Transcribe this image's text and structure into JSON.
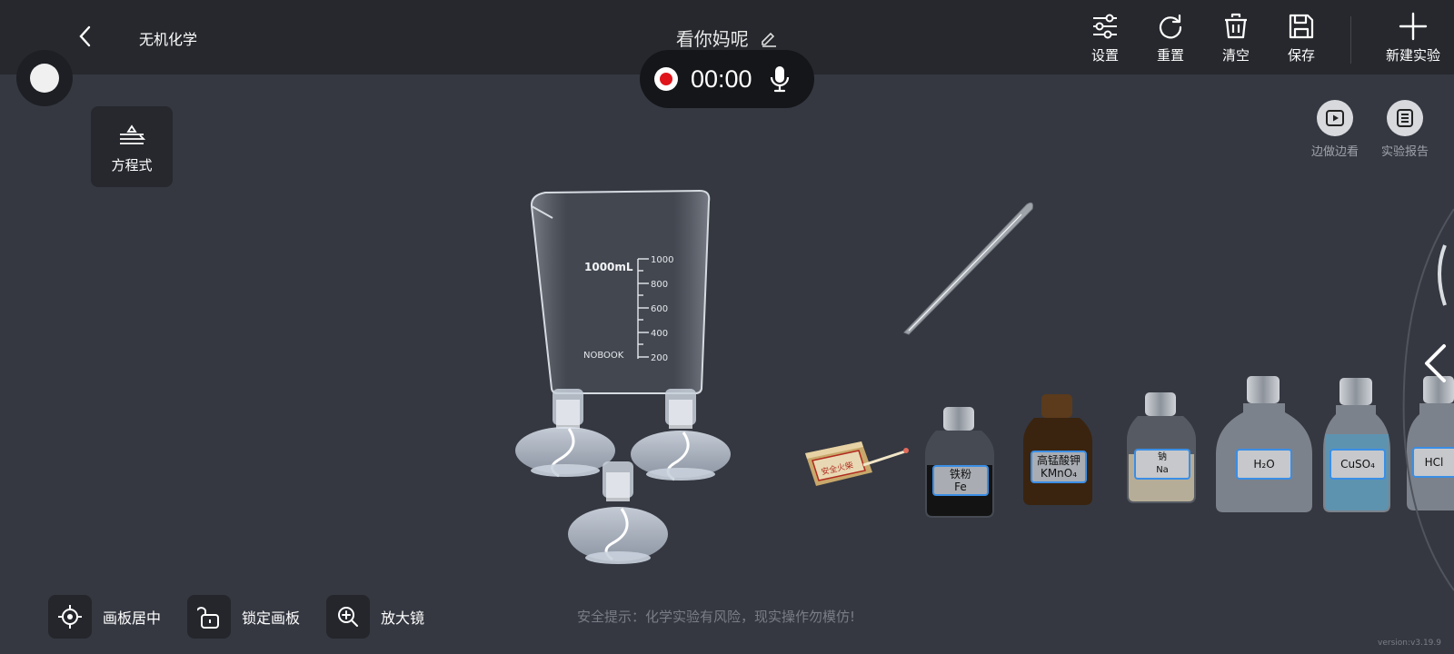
{
  "header": {
    "app_title": "无机化学",
    "experiment_title": "看你妈呢",
    "tools": [
      {
        "id": "settings",
        "label": "设置",
        "icon": "sliders-icon"
      },
      {
        "id": "reset",
        "label": "重置",
        "icon": "refresh-icon"
      },
      {
        "id": "clear",
        "label": "清空",
        "icon": "trash-icon"
      },
      {
        "id": "save",
        "label": "保存",
        "icon": "save-icon"
      },
      {
        "id": "new",
        "label": "新建实验",
        "icon": "plus-icon"
      }
    ]
  },
  "recorder": {
    "time": "00:00"
  },
  "left_panel": {
    "equation_label": "方程式"
  },
  "right_panel": {
    "watch_label": "边做边看",
    "report_label": "实验报告"
  },
  "canvas": {
    "beaker": {
      "capacity_label": "1000mL",
      "brand": "NOBOOK",
      "scale": [
        "1000",
        "800",
        "600",
        "400",
        "200"
      ]
    },
    "matchbox_text": "安全火柴",
    "reagents": [
      {
        "line1": "铁粉",
        "line2": "Fe",
        "liquid": "#131313"
      },
      {
        "line1": "高锰酸钾",
        "line2": "KMnO₄",
        "liquid": "#3a2410"
      },
      {
        "line1": "钠",
        "line2": "Na",
        "liquid": "#b6ad98"
      },
      {
        "line1": "",
        "line2": "H₂O",
        "liquid": "#8f959e"
      },
      {
        "line1": "",
        "line2": "CuSO₄",
        "liquid": "#5e93b0"
      },
      {
        "line1": "",
        "line2": "HCl",
        "liquid": "#8f959e"
      }
    ]
  },
  "bottom": {
    "center_label": "画板居中",
    "lock_label": "锁定画板",
    "magnifier_label": "放大镜",
    "safety_tip": "安全提示：化学实验有风险，现实操作勿模仿!",
    "version": "version:v3.19.9"
  },
  "colors": {
    "background": "#353841",
    "topbar": "#26282d",
    "record_red": "#e0151b",
    "label_border": "#3a8ee6"
  }
}
